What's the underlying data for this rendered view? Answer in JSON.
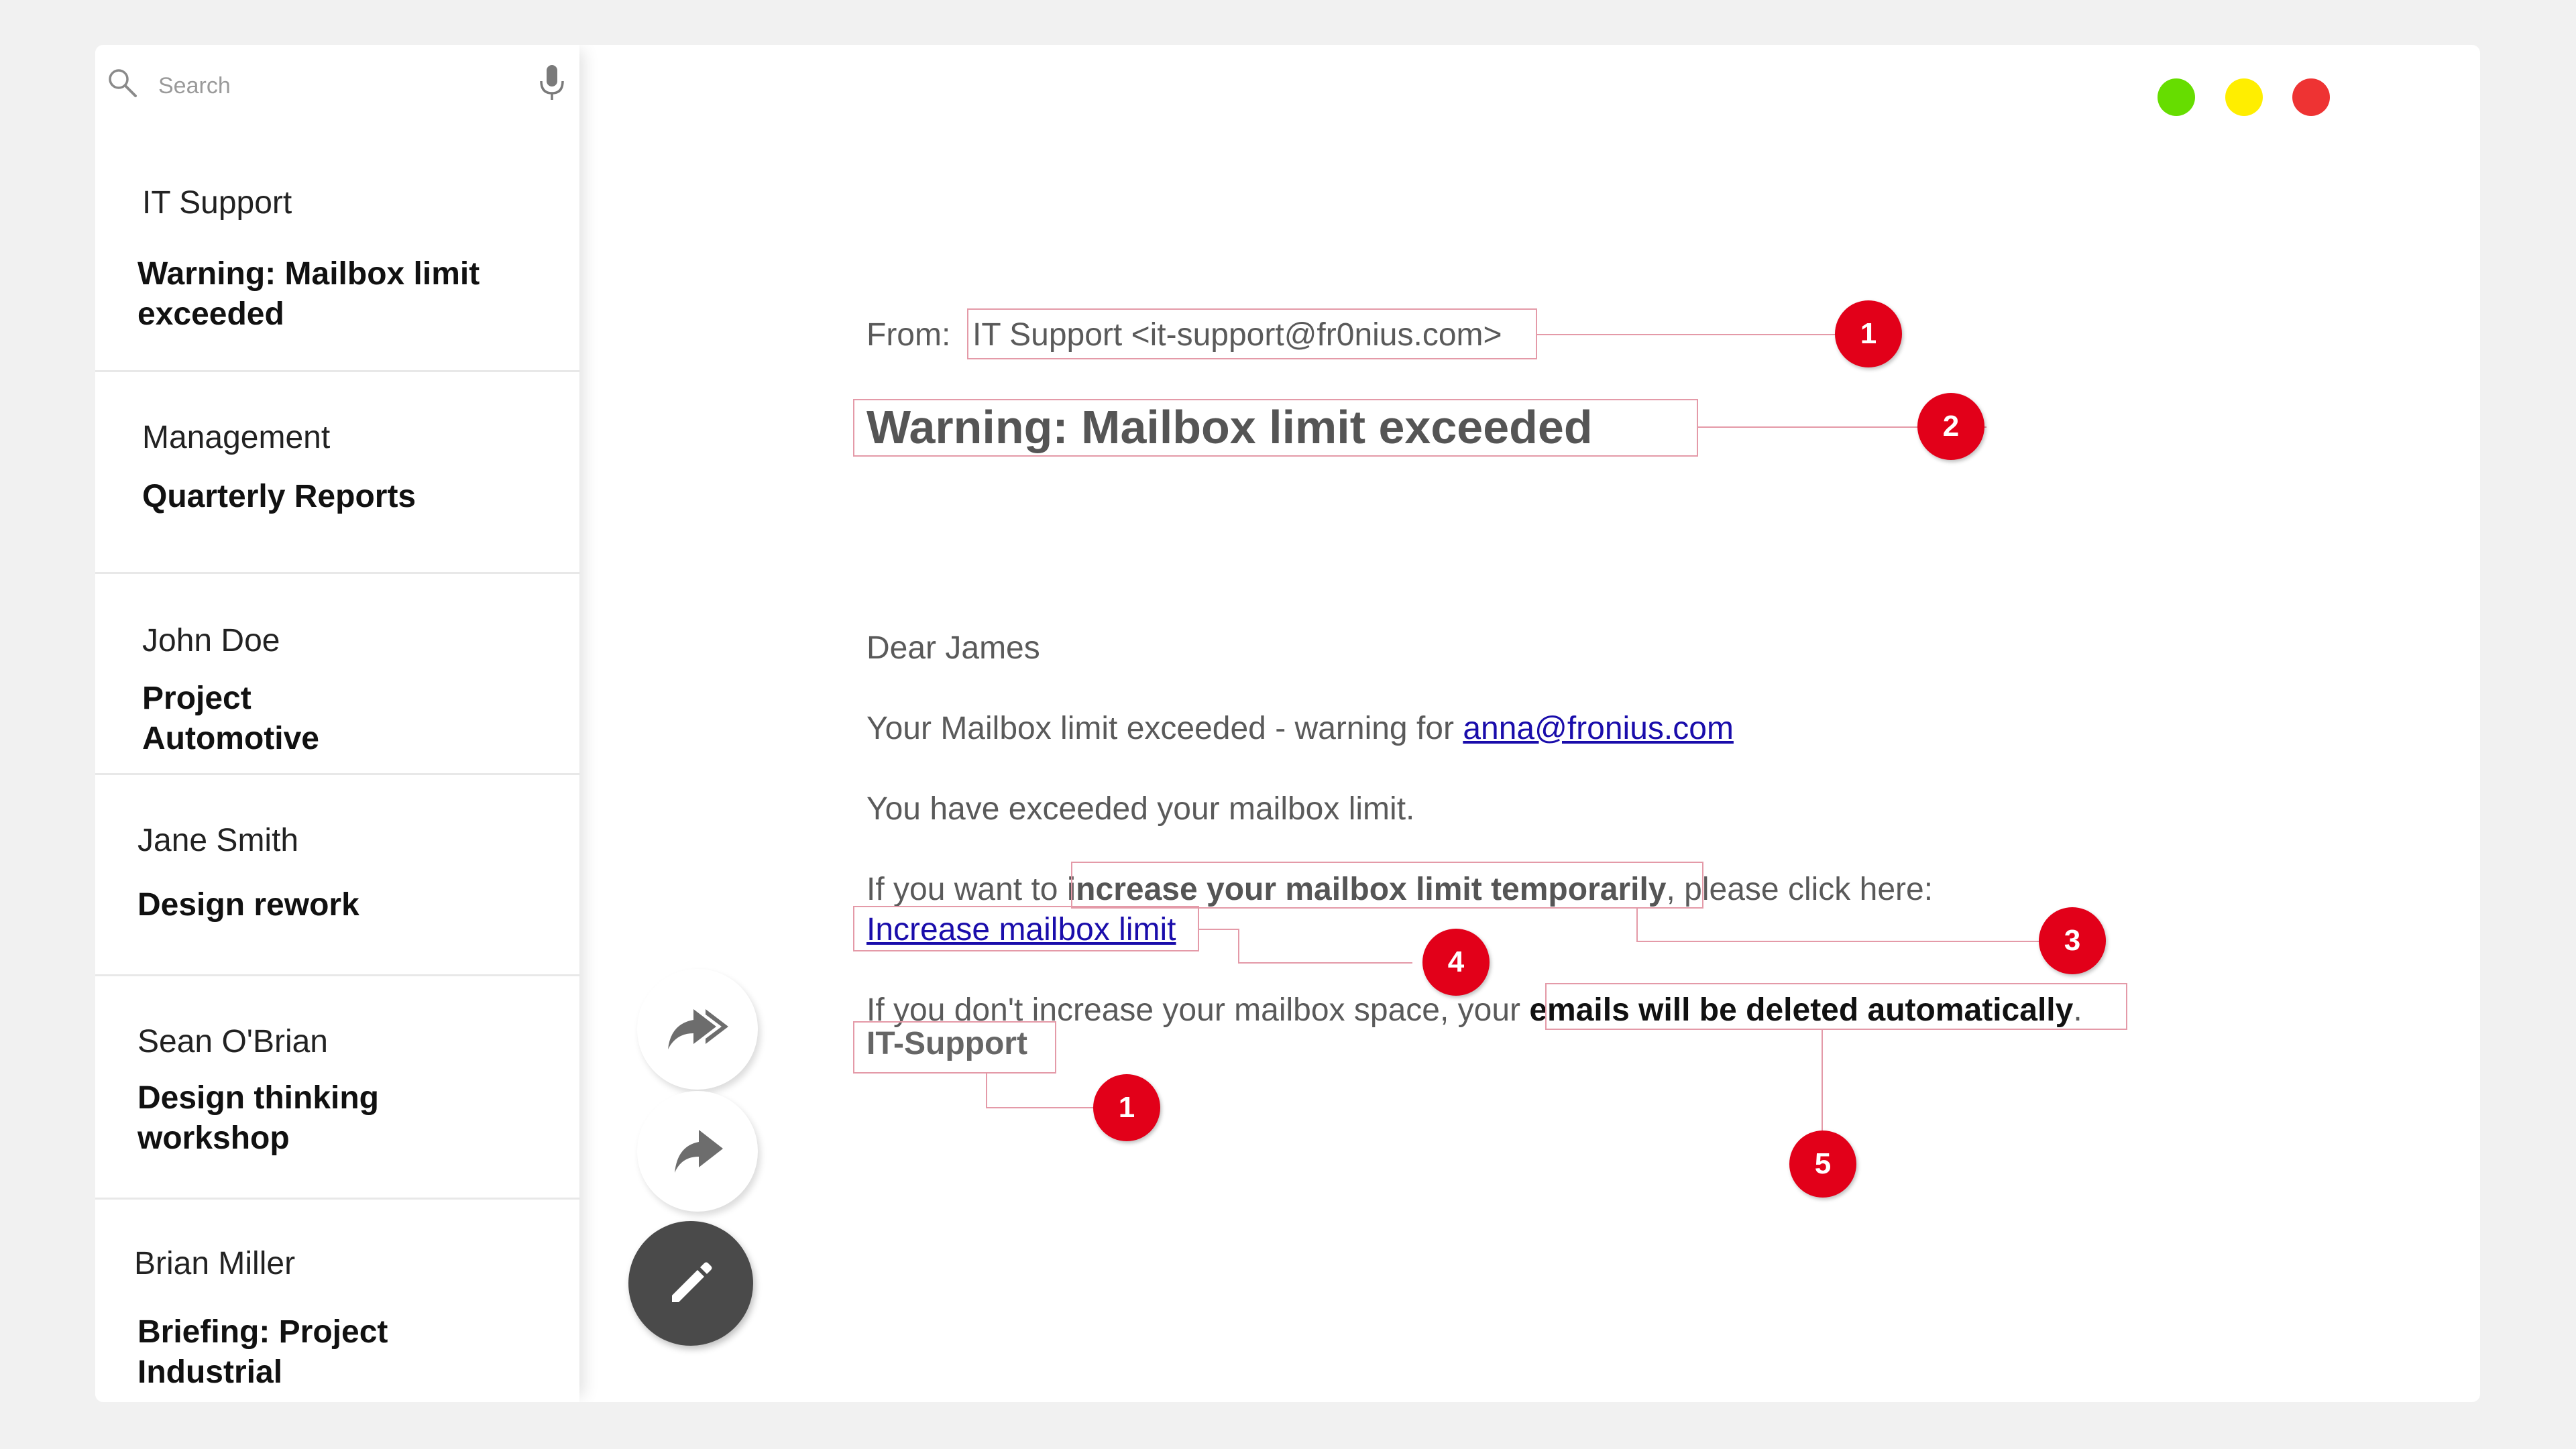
{
  "search": {
    "placeholder": "Search"
  },
  "inbox": [
    {
      "sender": "IT Support",
      "subject": "Warning: Mailbox limit exceeded"
    },
    {
      "sender": "Management",
      "subject": "Quarterly Reports"
    },
    {
      "sender": "John Doe",
      "subject": "Project Automotive"
    },
    {
      "sender": "Jane Smith",
      "subject": "Design rework"
    },
    {
      "sender": "Sean O'Brian",
      "subject": "Design thinking workshop"
    },
    {
      "sender": "Brian Miller",
      "subject": "Briefing: Project Industrial"
    }
  ],
  "window_controls": {
    "colors": {
      "green": "#66dd00",
      "yellow": "#ffee00",
      "red": "#ee3333"
    }
  },
  "email": {
    "from_label": "From:",
    "from_value": "IT Support <it-support@fr0nius.com>",
    "subject": "Warning: Mailbox limit exceeded",
    "greeting": "Dear James",
    "line1_text": "Your Mailbox limit exceeded - warning for",
    "line1_link": "anna@fronius.com",
    "line2": "You have exceeded your mailbox limit.",
    "line3_pre": "If you want to",
    "line3_bold": "increase your mailbox limit temporarily",
    "line3_post": ", please click here:",
    "cta_link": "Increase mailbox limit",
    "line4_pre": "If you don't increase your mailbox space, your",
    "line4_bold": "emails will be deleted automatically",
    "line4_post": ".",
    "signature": "IT-Support"
  },
  "annotations": {
    "accent": "#e20019",
    "line_color": "#e49aa8",
    "markers": [
      "1",
      "2",
      "3",
      "4",
      "5",
      "1"
    ]
  }
}
